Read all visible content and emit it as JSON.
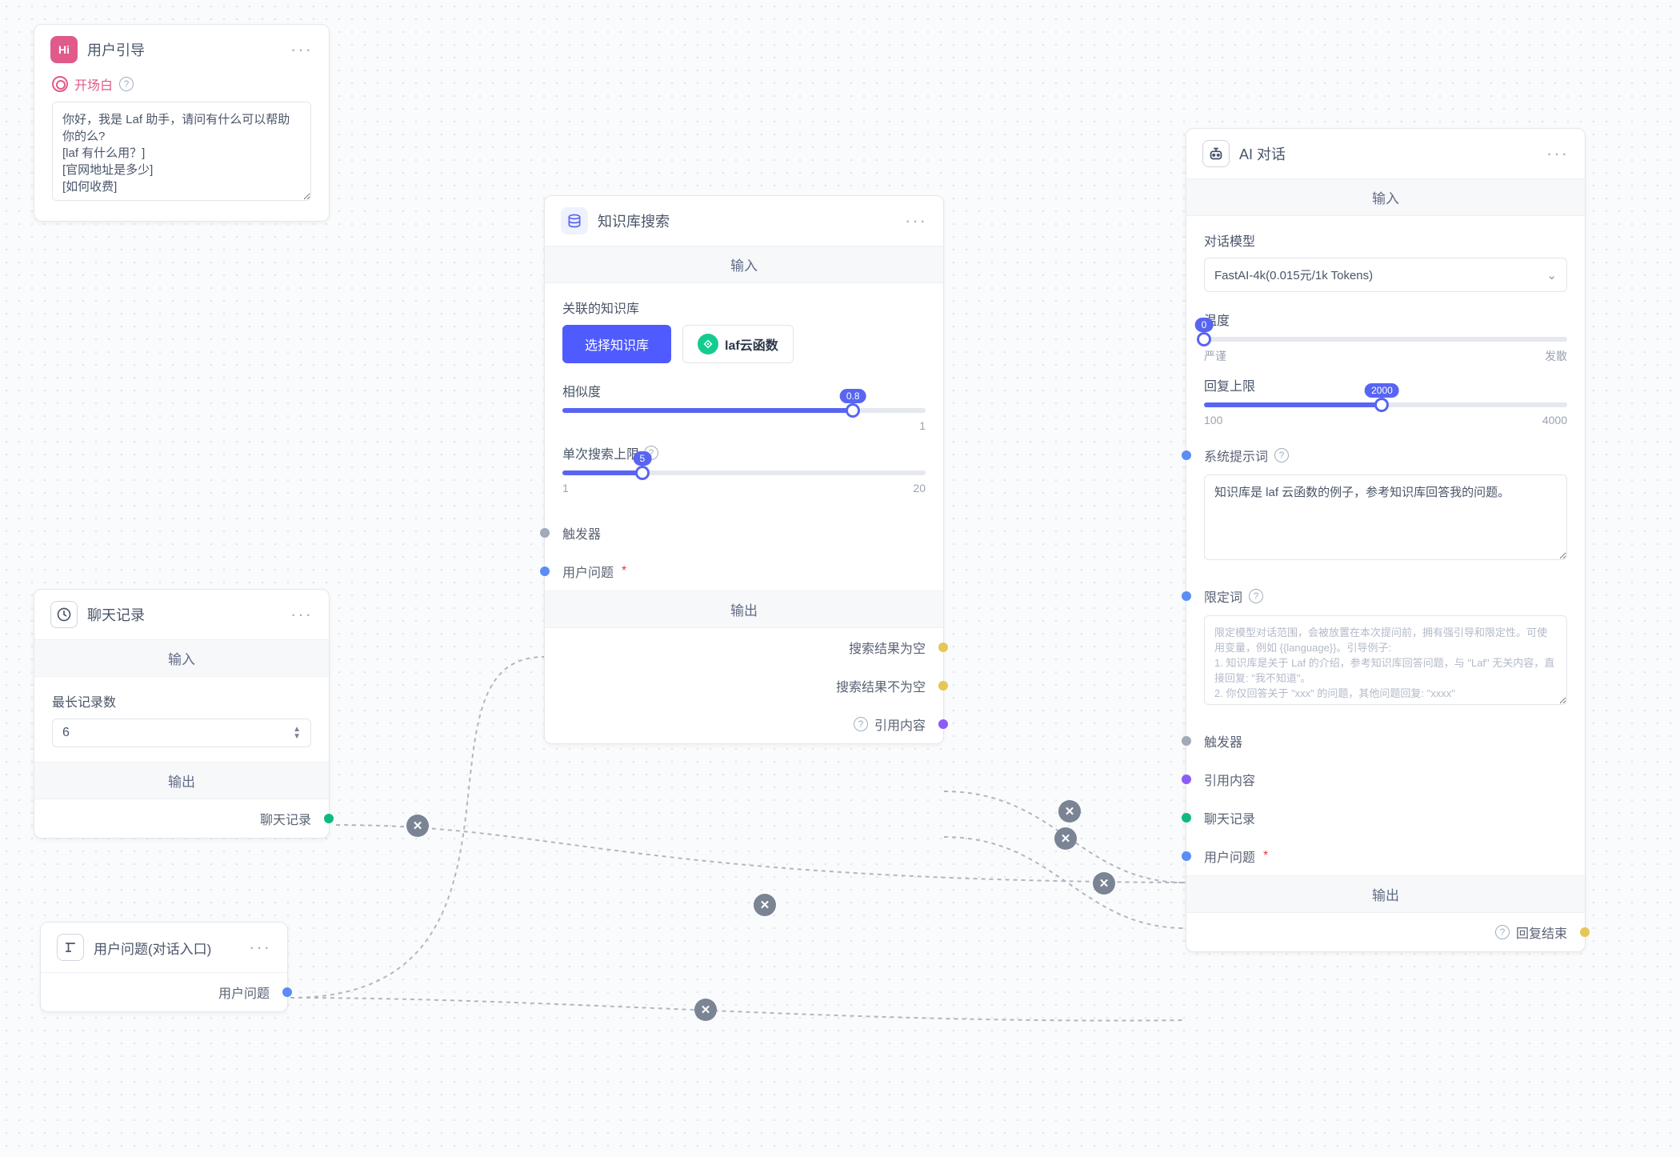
{
  "nodes": {
    "userGuide": {
      "title": "用户引导",
      "opening_label": "开场白",
      "opening_text": "你好，我是 Laf 助手，请问有什么可以帮助你的么?\n[laf 有什么用？]\n[官网地址是多少]\n[如何收费]"
    },
    "chatHistory": {
      "title": "聊天记录",
      "input_label": "输入",
      "maxRecords_label": "最长记录数",
      "maxRecords_value": "6",
      "output_label": "输出",
      "out_history": "聊天记录"
    },
    "userQuestion": {
      "title": "用户问题(对话入口)",
      "out_question": "用户问题"
    },
    "kbSearch": {
      "title": "知识库搜索",
      "input_label": "输入",
      "related_kb_label": "关联的知识库",
      "select_kb_btn": "选择知识库",
      "kb_chip": "laf云函数",
      "similarity_label": "相似度",
      "similarity_value": "0.8",
      "similarity_max": "1",
      "searchLimit_label": "单次搜索上限",
      "searchLimit_value": "5",
      "searchLimit_min": "1",
      "searchLimit_max": "20",
      "trigger_label": "触发器",
      "userq_label": "用户问题",
      "output_label": "输出",
      "empty_label": "搜索结果为空",
      "notempty_label": "搜索结果不为空",
      "quote_label": "引用内容"
    },
    "aiChat": {
      "title": "AI 对话",
      "input_label": "输入",
      "model_label": "对话模型",
      "model_value": "FastAI-4k(0.015元/1k Tokens)",
      "temp_label": "温度",
      "temp_value": "0",
      "temp_left": "严谨",
      "temp_right": "发散",
      "maxReply_label": "回复上限",
      "maxReply_value": "2000",
      "maxReply_min": "100",
      "maxReply_max": "4000",
      "sysPrompt_label": "系统提示词",
      "sysPrompt_text": "知识库是 laf 云函数的例子，参考知识库回答我的问题。",
      "limiter_label": "限定词",
      "limiter_placeholder": "限定模型对话范围，会被放置在本次提问前，拥有强引导和限定性。可使用变量，例如 {{language}}。引导例子:\n1. 知识库是关于 Laf 的介绍，参考知识库回答问题，与 \"Laf\" 无关内容，直接回复: \"我不知道\"。\n2. 你仅回答关于 \"xxx\" 的问题，其他问题回复: \"xxxx\"",
      "in_trigger": "触发器",
      "in_quote": "引用内容",
      "in_history": "聊天记录",
      "in_userq": "用户问题",
      "output_label": "输出",
      "out_end": "回复结束"
    }
  }
}
